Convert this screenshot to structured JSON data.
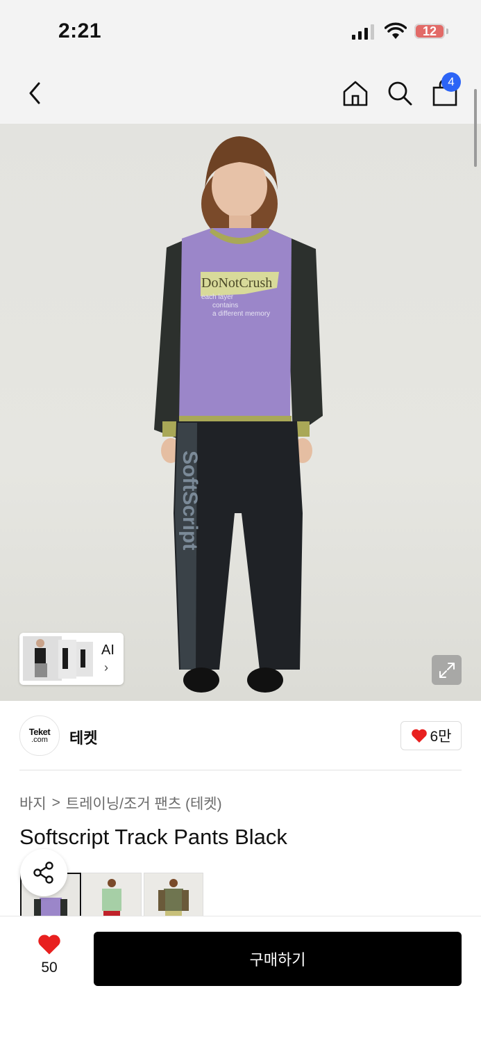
{
  "status_bar": {
    "time": "2:21",
    "battery": "12"
  },
  "header": {
    "cart_count": "4"
  },
  "hero": {
    "shirt_graphic_title": "DoNotCrush",
    "shirt_graphic_lines": [
      "each layer",
      "contains",
      "a different memory"
    ],
    "pants_text": "SoftScript",
    "ai_label": "AI",
    "ai_chevron": "›"
  },
  "brand": {
    "logo_top": "Teket",
    "logo_bottom": ".com",
    "name": "테켓",
    "likes": "6만"
  },
  "breadcrumb": {
    "category": "바지",
    "separator": ">",
    "subcategory": "트레이닝/조거 팬츠 (테켓)"
  },
  "product": {
    "title": "Softscript Track Pants Black"
  },
  "bottom": {
    "wish_count": "50",
    "buy_label": "구매하기"
  },
  "colors": {
    "heart": "#e8201f",
    "badge": "#2c64f6",
    "shirt": "#9b86c9",
    "sleeve": "#2b2f2c",
    "trim": "#a9a857",
    "pants": "#1f2226"
  }
}
